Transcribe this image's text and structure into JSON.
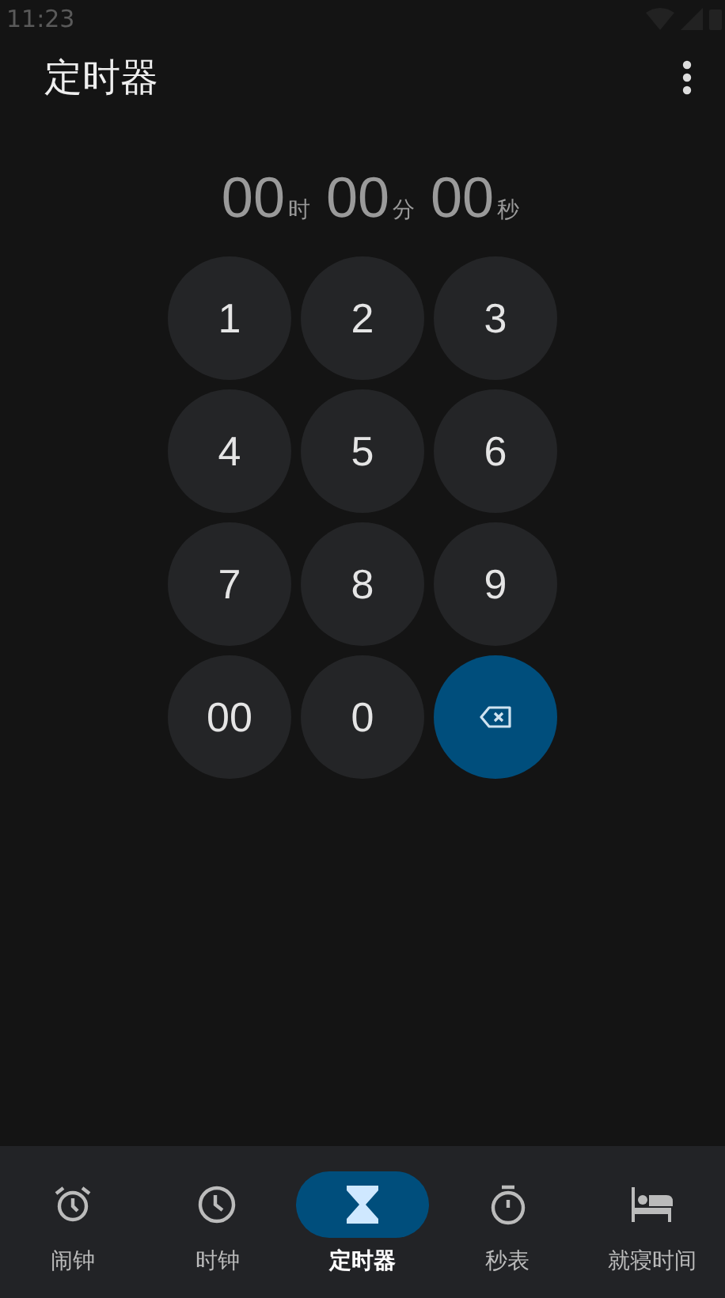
{
  "status_bar": {
    "time": "11:23"
  },
  "app_bar": {
    "title": "定时器"
  },
  "timer": [
    {
      "value": "00",
      "unit": "时"
    },
    {
      "value": "00",
      "unit": "分"
    },
    {
      "value": "00",
      "unit": "秒"
    }
  ],
  "keypad": [
    {
      "kind": "digit",
      "label": "1"
    },
    {
      "kind": "digit",
      "label": "2"
    },
    {
      "kind": "digit",
      "label": "3"
    },
    {
      "kind": "digit",
      "label": "4"
    },
    {
      "kind": "digit",
      "label": "5"
    },
    {
      "kind": "digit",
      "label": "6"
    },
    {
      "kind": "digit",
      "label": "7"
    },
    {
      "kind": "digit",
      "label": "8"
    },
    {
      "kind": "digit",
      "label": "9"
    },
    {
      "kind": "digit",
      "label": "00"
    },
    {
      "kind": "digit",
      "label": "0"
    },
    {
      "kind": "backspace"
    }
  ],
  "nav": [
    {
      "kind": "alarm",
      "label": "闹钟",
      "selected": false
    },
    {
      "kind": "clock",
      "label": "时钟",
      "selected": false
    },
    {
      "kind": "timer",
      "label": "定时器",
      "selected": true
    },
    {
      "kind": "stopwatch",
      "label": "秒表",
      "selected": false
    },
    {
      "kind": "bedtime",
      "label": "就寝时间",
      "selected": false
    }
  ]
}
